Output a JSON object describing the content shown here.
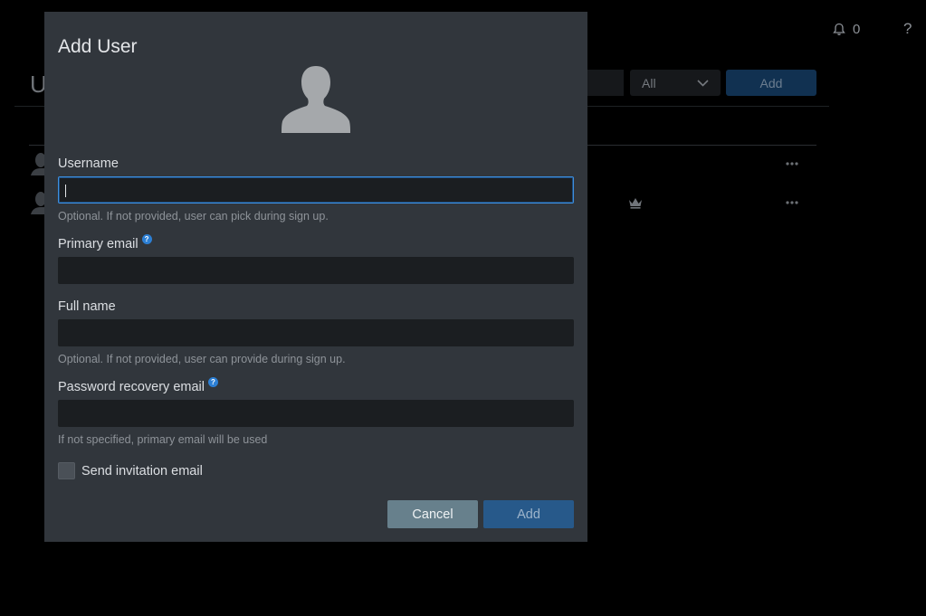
{
  "background": {
    "notifications_count": "0",
    "help_label": "?",
    "page_title_fragment": "U",
    "filter_select_value": "All",
    "add_button_label": "Add"
  },
  "modal": {
    "title": "Add User",
    "fields": {
      "username": {
        "label": "Username",
        "value": "",
        "hint": "Optional. If not provided, user can pick during sign up."
      },
      "primary_email": {
        "label": "Primary email",
        "value": ""
      },
      "full_name": {
        "label": "Full name",
        "value": "",
        "hint": "Optional. If not provided, user can provide during sign up."
      },
      "recovery_email": {
        "label": "Password recovery email",
        "value": "",
        "hint": "If not specified, primary email will be used"
      }
    },
    "send_invitation": {
      "label": "Send invitation email",
      "checked": false
    },
    "cancel_label": "Cancel",
    "add_label": "Add",
    "help_icon_glyph": "?"
  },
  "colors": {
    "modal_bg": "#31363c",
    "input_bg": "#1b1e21",
    "focus_border": "#3d8fdf",
    "cancel_button": "#67808c",
    "add_button": "#27598a",
    "help_icon": "#2c7fd4"
  },
  "icons": {
    "notifications": "bell-icon",
    "help": "question-icon",
    "avatar": "user-silhouette-icon",
    "row_actions": "ellipsis-icon",
    "admin": "crown-icon",
    "select_toggle": "chevron-down-icon",
    "field_help": "info-circle-icon"
  }
}
